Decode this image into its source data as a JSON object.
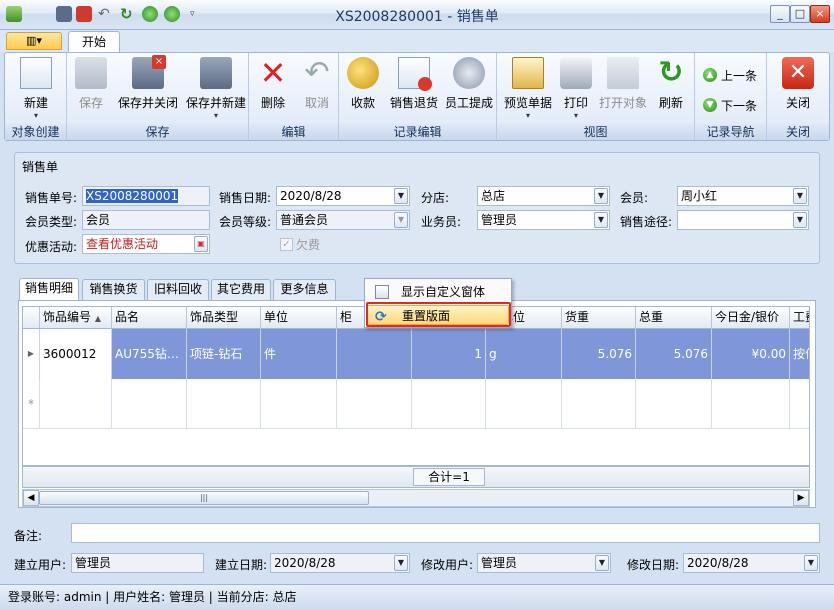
{
  "window": {
    "title": "XS2008280001 - 销售单",
    "controls": {
      "min": "_",
      "max": "□",
      "close": "×"
    }
  },
  "ribbon": {
    "app_button": "▥▾",
    "tab": "开始",
    "groups": [
      {
        "label": "对象创建",
        "buttons": [
          "新建"
        ]
      },
      {
        "label": "保存",
        "buttons": [
          "保存",
          "保存并关闭",
          "保存并新建"
        ]
      },
      {
        "label": "编辑",
        "buttons": [
          "删除",
          "取消"
        ]
      },
      {
        "label": "记录编辑",
        "buttons": [
          "收款",
          "销售退货",
          "员工提成"
        ]
      },
      {
        "label": "视图",
        "buttons": [
          "预览单据",
          "打印",
          "打开对象",
          "刷新"
        ]
      },
      {
        "label": "记录导航",
        "buttons": [
          "上一条",
          "下一条"
        ]
      },
      {
        "label": "关闭",
        "buttons": [
          "关闭"
        ]
      }
    ]
  },
  "form": {
    "title": "销售单",
    "order_no_label": "销售单号:",
    "order_no": "XS2008280001",
    "date_label": "销售日期:",
    "date": "2020/8/28",
    "branch_label": "分店:",
    "branch": "总店",
    "member_label": "会员:",
    "member": "周小红",
    "member_type_label": "会员类型:",
    "member_type": "会员",
    "member_level_label": "会员等级:",
    "member_level": "普通会员",
    "salesman_label": "业务员:",
    "salesman": "管理员",
    "channel_label": "销售途径:",
    "channel": "",
    "promo_label": "优惠活动:",
    "promo": "查看优惠活动",
    "owed_label": "欠费"
  },
  "grid_tabs": [
    "销售明细",
    "销售换货",
    "旧料回收",
    "其它费用",
    "更多信息"
  ],
  "grid": {
    "columns": [
      "饰品编号",
      "品名",
      "饰品类型",
      "单位",
      "柜",
      "",
      "重单位",
      "货重",
      "总重",
      "今日金/银价",
      "工费"
    ],
    "rows": [
      [
        "3600012",
        "AU755钻…",
        "项链-钻石",
        "件",
        "",
        "1",
        "g",
        "5.076",
        "5.076",
        "¥0.00",
        "按件"
      ]
    ],
    "new_row_marker": "*",
    "sum": "合计=1"
  },
  "context_menu": {
    "items": [
      "显示自定义窗体",
      "重置版面"
    ]
  },
  "bottom": {
    "remark_label": "备注:",
    "remark": "",
    "creator_label": "建立用户:",
    "creator": "管理员",
    "created_label": "建立日期:",
    "created": "2020/8/28",
    "modifier_label": "修改用户:",
    "modifier": "管理员",
    "modified_label": "修改日期:",
    "modified": "2020/8/28"
  },
  "status": {
    "text": "登录账号: admin  |  用户姓名: 管理员  |  当前分店: 总店"
  }
}
